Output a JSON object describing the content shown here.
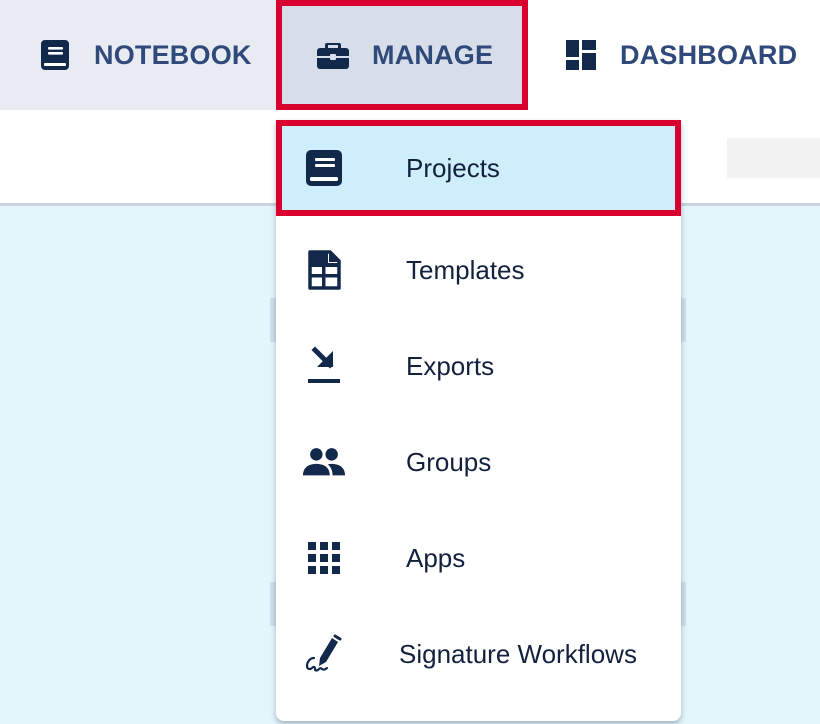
{
  "nav": {
    "tabs": [
      {
        "label": "NOTEBOOK",
        "icon": "notebook-icon"
      },
      {
        "label": "MANAGE",
        "icon": "briefcase-icon",
        "selected": true
      },
      {
        "label": "DASHBOARD",
        "icon": "dashboard-icon"
      }
    ]
  },
  "menu": {
    "items": [
      {
        "label": "Projects",
        "icon": "book-icon",
        "selected": true
      },
      {
        "label": "Templates",
        "icon": "template-icon"
      },
      {
        "label": "Exports",
        "icon": "export-icon"
      },
      {
        "label": "Groups",
        "icon": "group-icon"
      },
      {
        "label": "Apps",
        "icon": "apps-grid-icon"
      },
      {
        "label": "Signature Workflows",
        "icon": "signature-icon"
      }
    ]
  },
  "colors": {
    "highlight_border": "#d9002f",
    "nav_text": "#2f4a7a",
    "icon_navy": "#13294b",
    "selected_item_bg": "#cdeefa",
    "page_bg": "#e4f5fc"
  }
}
